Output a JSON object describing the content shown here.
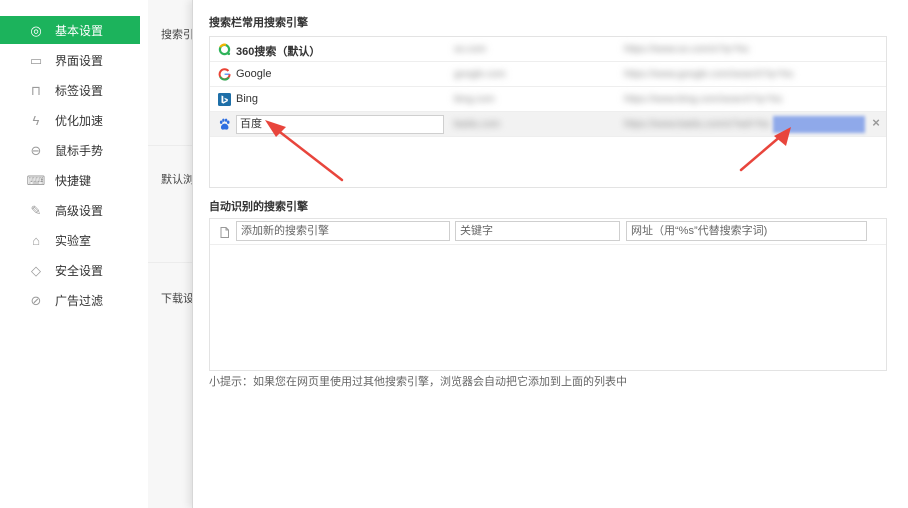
{
  "sidebar": {
    "items": [
      {
        "label": "基本设置",
        "icon": "circle-dot-icon",
        "glyph": "◎",
        "active": true
      },
      {
        "label": "界面设置",
        "icon": "window-icon",
        "glyph": "▭",
        "active": false
      },
      {
        "label": "标签设置",
        "icon": "tab-icon",
        "glyph": "⊓",
        "active": false
      },
      {
        "label": "优化加速",
        "icon": "lightning-icon",
        "glyph": "ϟ",
        "active": false
      },
      {
        "label": "鼠标手势",
        "icon": "mouse-icon",
        "glyph": "⊖",
        "active": false
      },
      {
        "label": "快捷键",
        "icon": "keyboard-icon",
        "glyph": "⌨",
        "active": false
      },
      {
        "label": "高级设置",
        "icon": "wrench-icon",
        "glyph": "✎",
        "active": false
      },
      {
        "label": "实验室",
        "icon": "flask-icon",
        "glyph": "⌂",
        "active": false
      },
      {
        "label": "安全设置",
        "icon": "shield-icon",
        "glyph": "◇",
        "active": false
      },
      {
        "label": "广告过滤",
        "icon": "block-icon",
        "glyph": "⊘",
        "active": false
      }
    ],
    "active_color": "#1cb35c"
  },
  "middle": {
    "labels": [
      "搜索引",
      "默认浏",
      "下载设"
    ]
  },
  "dialog": {
    "common_title": "搜索栏常用搜索引擎",
    "engines": [
      {
        "name": "360搜索（默认）",
        "icon": "360-search-icon",
        "keyword": "so.com",
        "url": "https://www.so.com/s?q=%s",
        "bold": true
      },
      {
        "name": "Google",
        "icon": "google-icon",
        "keyword": "google.com",
        "url": "https://www.google.com/search?q=%s",
        "bold": false
      },
      {
        "name": "Bing",
        "icon": "bing-icon",
        "keyword": "bing.com",
        "url": "https://www.bing.com/search?q=%s",
        "bold": false
      }
    ],
    "editing_engine": {
      "name": "百度",
      "icon": "baidu-paw-icon",
      "keyword": "baidu.com",
      "url": "https://www.baidu.com/s?wd=%s"
    },
    "delete_glyph": "×",
    "auto_title": "自动识别的搜索引擎",
    "new_engine": {
      "name_placeholder": "添加新的搜索引擎",
      "keyword_placeholder": "关键字",
      "url_placeholder": "网址（用“%s”代替搜索字词)"
    },
    "tip": "小提示：如果您在网页里使用过其他搜索引擎，浏览器会自动把它添加到上面的列表中"
  },
  "annotation_color": "#e8453c"
}
